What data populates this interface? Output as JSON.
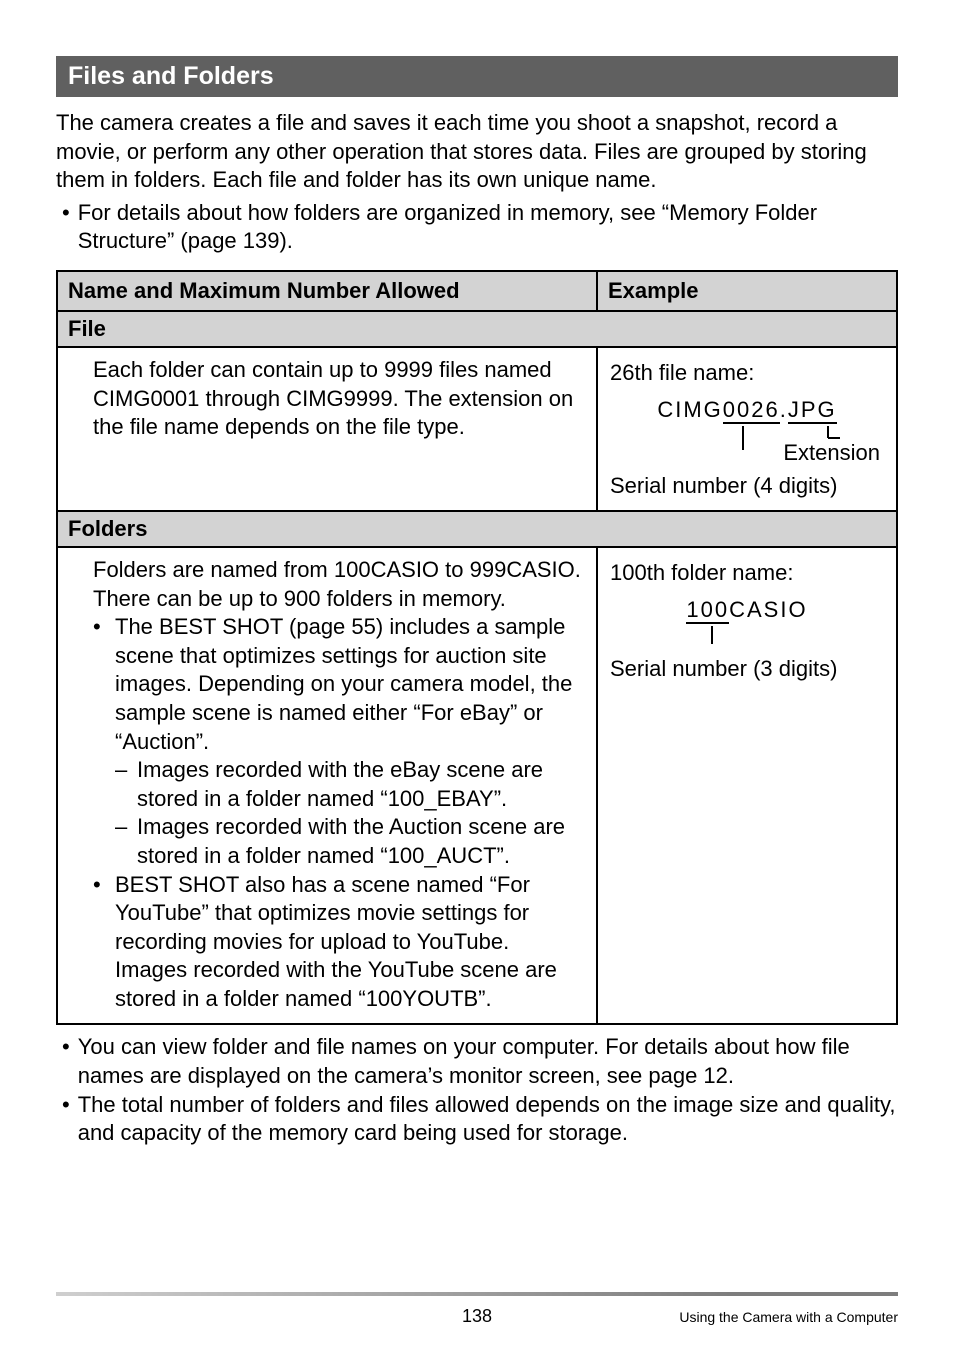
{
  "section": {
    "title": "Files and Folders",
    "intro": "The camera creates a file and saves it each time you shoot a snapshot, record a movie, or perform any other operation that stores data. Files are grouped by storing them in folders. Each file and folder has its own unique name.",
    "intro_bullet": "For details about how folders are organized in memory, see “Memory Folder Structure” (page 139)."
  },
  "table": {
    "head_name": "Name and Maximum Number Allowed",
    "head_example": "Example",
    "file_label": "File",
    "file_desc": "Each folder can contain up to 9999 files named CIMG0001 through CIMG9999. The extension on the file name depends on the file type.",
    "file_example_label": "26th file name:",
    "file_example_prefix": "CIMG",
    "file_example_serial": "0026",
    "file_example_dot": ".",
    "file_example_ext": "JPG",
    "file_example_ext_label": "Extension",
    "file_example_serial_label": "Serial number (4 digits)",
    "folder_label": "Folders",
    "folder_desc_1": "Folders are named from 100CASIO to 999CASIO.",
    "folder_desc_2": "There can be up to 900 folders in memory.",
    "folder_bullet_1": "The BEST SHOT (page 55) includes a sample scene that optimizes settings for auction site images. Depending on your camera model, the sample scene is named either “For eBay” or “Auction”.",
    "folder_dash_1": "Images recorded with the eBay scene are stored in a folder named “100_EBAY”.",
    "folder_dash_2": "Images recorded with the Auction scene are stored in a folder named “100_AUCT”.",
    "folder_bullet_2": "BEST SHOT also has a scene named “For YouTube” that optimizes movie settings for recording movies for upload to YouTube. Images recorded with the YouTube scene are stored in a folder named “100YOUTB”.",
    "folder_example_label": "100th folder name:",
    "folder_example_serial": "100",
    "folder_example_suffix": "CASIO",
    "folder_example_serial_label": "Serial number (3 digits)"
  },
  "after": {
    "bullet_1": "You can view folder and file names on your computer. For details about how file names are displayed on the camera’s monitor screen, see page 12.",
    "bullet_2": "The total number of folders and files allowed depends on the image size and quality, and capacity of the memory card being used for storage."
  },
  "footer": {
    "page_number": "138",
    "section_name": "Using the Camera with a Computer"
  }
}
